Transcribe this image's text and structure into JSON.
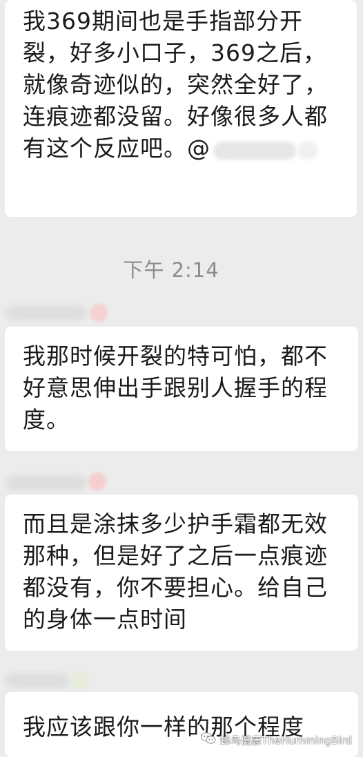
{
  "messages": [
    {
      "text": "我369期间也是手指部分开裂，好多小口子，369之后，就像奇迹似的，突然全好了，连痕迹都没留。好像很多人都有这个反应吧。@"
    },
    {
      "text": "我那时候开裂的特可怕，都不好意思伸出手跟别人握手的程度。"
    },
    {
      "text": "而且是涂抹多少护手霜都无效那种，但是好了之后一点痕迹都没有，你不要担心。给自己的身体一点时间"
    },
    {
      "text": "我应该跟你一样的那个程度"
    }
  ],
  "timestamp": "下午 2:14",
  "watermark": {
    "icon": "wechat-icon",
    "text": "蜂鸟健康TheHummingBird"
  },
  "colors": {
    "background": "#ececec",
    "bubble": "#ffffff",
    "text": "#1a1a1a",
    "timestamp": "#8c8c8c"
  }
}
